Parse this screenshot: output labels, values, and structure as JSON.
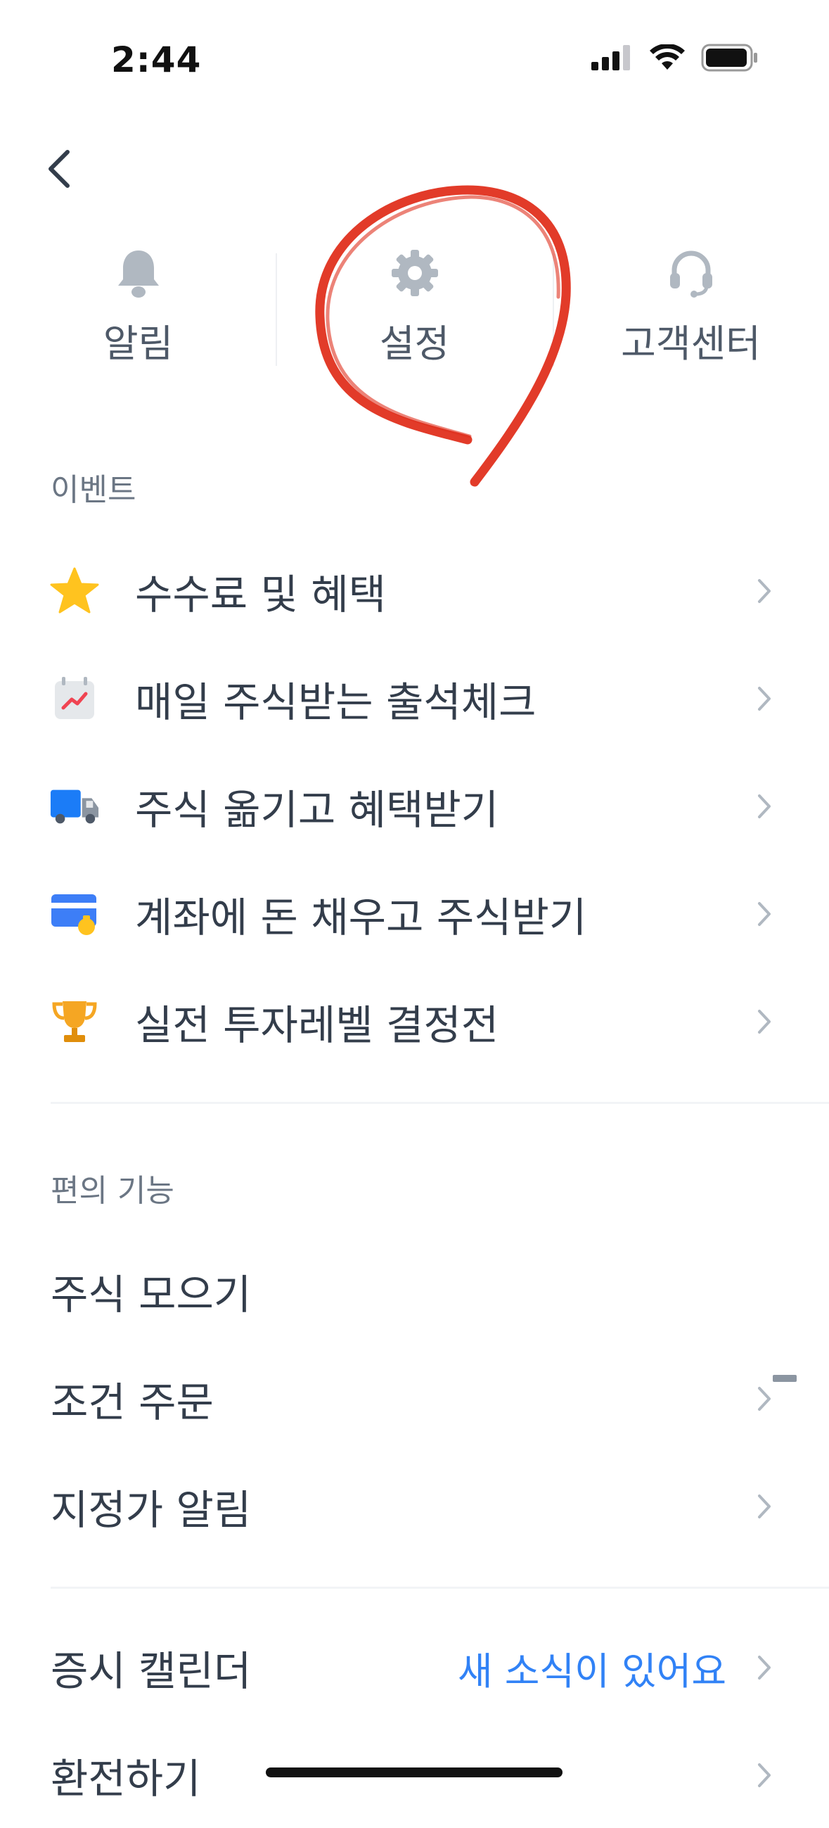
{
  "status_bar": {
    "time": "2:44"
  },
  "shortcuts": [
    {
      "label": "알림",
      "icon": "bell-icon"
    },
    {
      "label": "설정",
      "icon": "gear-icon"
    },
    {
      "label": "고객센터",
      "icon": "headset-icon"
    }
  ],
  "events": {
    "title": "이벤트",
    "items": [
      {
        "label": "수수료 및 혜택",
        "icon": "star-icon"
      },
      {
        "label": "매일 주식받는 출석체크",
        "icon": "calendar-icon"
      },
      {
        "label": "주식 옮기고 혜택받기",
        "icon": "truck-icon"
      },
      {
        "label": "계좌에 돈 채우고 주식받기",
        "icon": "card-icon"
      },
      {
        "label": "실전 투자레벨 결정전",
        "icon": "trophy-icon"
      }
    ]
  },
  "convenience": {
    "title": "편의 기능",
    "items": [
      {
        "label": "주식 모으기"
      },
      {
        "label": "조건 주문"
      },
      {
        "label": "지정가 알림"
      }
    ]
  },
  "more": {
    "items": [
      {
        "label": "증시 캘린더",
        "value": "새 소식이 있어요"
      },
      {
        "label": "환전하기"
      }
    ]
  },
  "colors": {
    "accent": "#3182f6",
    "text": "#333d4b",
    "muted": "#6b7684",
    "icon_gray": "#b0b8c1",
    "annotation": "#e0301e"
  }
}
